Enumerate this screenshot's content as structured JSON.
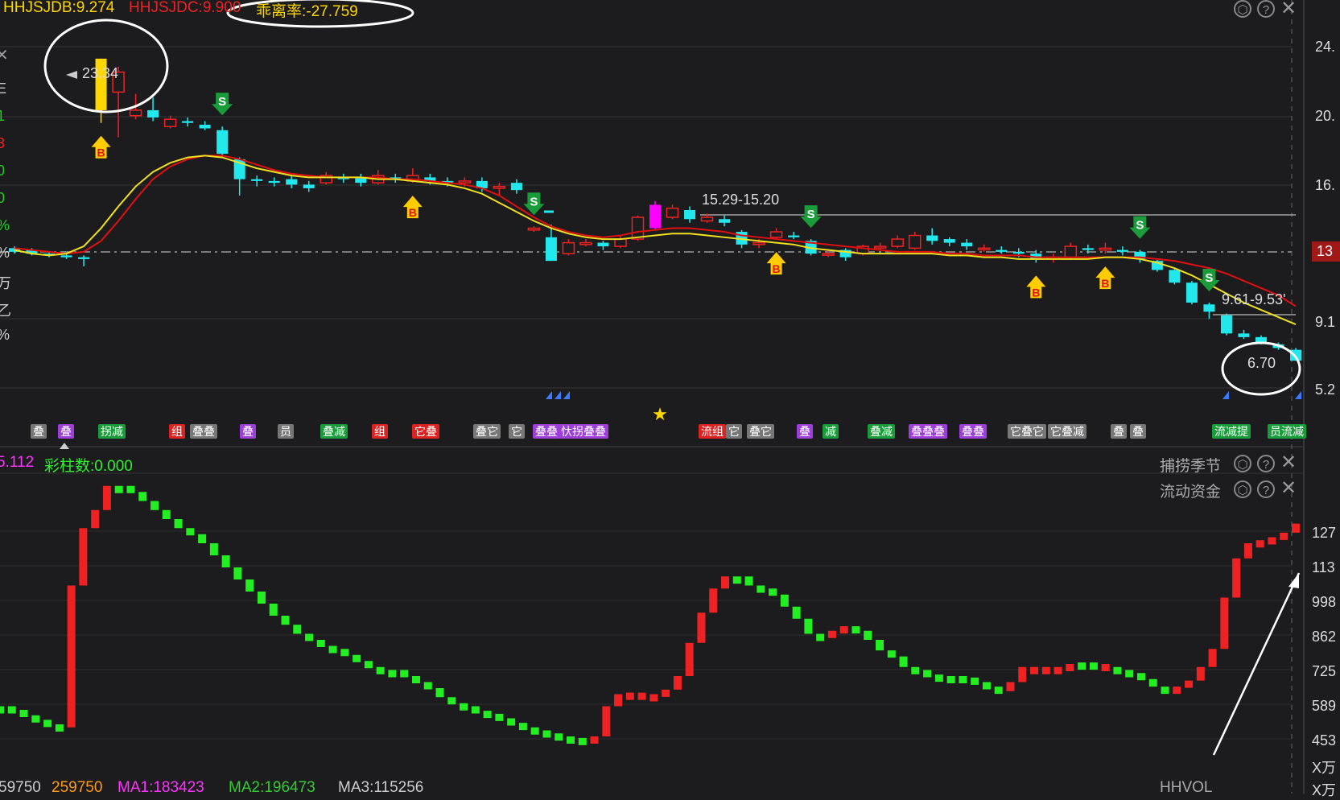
{
  "upper_header": {
    "hhjsjdb": "HHJSJDB:9.274",
    "hhjsjdc": "HHJSJDC:9.900",
    "deviation": "乖离率:-27.759"
  },
  "lower_header": {
    "value1": "5.112",
    "caizhu": "彩柱数:0.000",
    "panel_name_1": "捕捞季节",
    "panel_name_2": "流动资金"
  },
  "bottom_status": {
    "v0": "59750",
    "v1": "259750",
    "ma1": "MA1:183423",
    "ma2": "MA2:196473",
    "ma3": "MA3:115256",
    "right_name": "HHVOL"
  },
  "price_axis": [
    "24.",
    "20.",
    "16.",
    "13",
    "9.1",
    "5.2"
  ],
  "volume_axis": [
    "127",
    "113",
    "998",
    "862",
    "725",
    "589",
    "453",
    "X万",
    "X万"
  ],
  "annotations": {
    "high": "23.34",
    "range1": "15.29-15.20",
    "range2": "9.61-9.53'",
    "low": "6.70"
  },
  "left_edge_labels": [
    {
      "text": "E",
      "color": "#cccccc"
    },
    {
      "text": "1",
      "color": "#22cc22"
    },
    {
      "text": "3",
      "color": "#ee2222"
    },
    {
      "text": "0",
      "color": "#22cc22"
    },
    {
      "text": "0",
      "color": "#22cc22"
    },
    {
      "text": "%",
      "color": "#22cc22"
    },
    {
      "text": "%",
      "color": "#cccccc"
    },
    {
      "text": "万",
      "color": "#cccccc"
    },
    {
      "text": "乙",
      "color": "#cccccc"
    },
    {
      "text": "%",
      "color": "#cccccc"
    }
  ],
  "signal_tags": [
    {
      "text": "叠",
      "color": "#777777"
    },
    {
      "text": "叠",
      "color": "#9b3fd6"
    },
    {
      "text": "拐减",
      "color": "#1a9c3a"
    },
    {
      "text": "组",
      "color": "#dd2222"
    },
    {
      "text": "叠叠",
      "color": "#777777"
    },
    {
      "text": "叠",
      "color": "#9b3fd6"
    },
    {
      "text": "员",
      "color": "#777777"
    },
    {
      "text": "叠减",
      "color": "#1a9c3a"
    },
    {
      "text": "组",
      "color": "#dd2222"
    },
    {
      "text": "它叠",
      "color": "#dd2222"
    },
    {
      "text": "叠它",
      "color": "#777777"
    },
    {
      "text": "它",
      "color": "#777777"
    },
    {
      "text": "叠叠",
      "color": "#9b3fd6"
    },
    {
      "text": "忕拐叠叠",
      "color": "#9b3fd6"
    },
    {
      "text": "流组",
      "color": "#dd2222"
    },
    {
      "text": "它",
      "color": "#777777"
    },
    {
      "text": "叠它",
      "color": "#777777"
    },
    {
      "text": "叠",
      "color": "#9b3fd6"
    },
    {
      "text": "减",
      "color": "#1a9c3a"
    },
    {
      "text": "叠减",
      "color": "#1a9c3a"
    },
    {
      "text": "叠叠叠",
      "color": "#9b3fd6"
    },
    {
      "text": "叠叠",
      "color": "#9b3fd6"
    },
    {
      "text": "它叠它",
      "color": "#777777"
    },
    {
      "text": "它叠减",
      "color": "#777777"
    },
    {
      "text": "叠",
      "color": "#777777"
    },
    {
      "text": "叠",
      "color": "#777777"
    },
    {
      "text": "流减提",
      "color": "#1a9c3a"
    },
    {
      "text": "员流减",
      "color": "#1a9c3a"
    }
  ],
  "markers": {
    "buy": "B",
    "sell": "S"
  },
  "icons": [
    "settings-hex-icon",
    "help-icon",
    "close-icon",
    "collapse-icon",
    "star-icon",
    "arrow-up-right-icon"
  ],
  "colors": {
    "up": "#ee2222",
    "down": "#22e8ee",
    "yellow": "#ffd700",
    "magenta": "#ff00ff",
    "green_bar": "#22ee22"
  },
  "chart_data": [
    {
      "type": "candlestick",
      "title": "",
      "ylim": [
        5.2,
        24.0
      ],
      "price_ticks": [
        "24.",
        "20.",
        "16.",
        "13",
        "9.1",
        "5.2"
      ],
      "candles": [
        {
          "o": 12.9,
          "c": 12.7,
          "h": 13.0,
          "l": 12.6
        },
        {
          "o": 12.8,
          "c": 12.6,
          "h": 12.9,
          "l": 12.5
        },
        {
          "o": 12.6,
          "c": 12.5,
          "h": 12.7,
          "l": 12.4
        },
        {
          "o": 12.5,
          "c": 12.4,
          "h": 12.6,
          "l": 12.3
        },
        {
          "o": 12.4,
          "c": 12.3,
          "h": 12.5,
          "l": 11.9
        },
        {
          "o": 20.5,
          "c": 23.34,
          "h": 23.34,
          "l": 19.8
        },
        {
          "o": 21.5,
          "c": 22.6,
          "h": 22.9,
          "l": 19.0
        },
        {
          "o": 20.2,
          "c": 20.5,
          "h": 21.4,
          "l": 20.0
        },
        {
          "o": 20.5,
          "c": 20.1,
          "h": 21.2,
          "l": 19.9
        },
        {
          "o": 19.6,
          "c": 20.0,
          "h": 20.2,
          "l": 19.5
        },
        {
          "o": 19.9,
          "c": 19.8,
          "h": 20.1,
          "l": 19.6
        },
        {
          "o": 19.7,
          "c": 19.5,
          "h": 19.9,
          "l": 19.4
        },
        {
          "o": 19.4,
          "c": 18.1,
          "h": 19.6,
          "l": 17.9
        },
        {
          "o": 17.8,
          "c": 16.7,
          "h": 17.9,
          "l": 15.8
        },
        {
          "o": 16.7,
          "c": 16.6,
          "h": 16.9,
          "l": 16.3
        },
        {
          "o": 16.6,
          "c": 16.5,
          "h": 16.8,
          "l": 16.3
        },
        {
          "o": 16.7,
          "c": 16.4,
          "h": 16.9,
          "l": 16.2
        },
        {
          "o": 16.4,
          "c": 16.2,
          "h": 16.6,
          "l": 16.0
        },
        {
          "o": 16.5,
          "c": 16.9,
          "h": 17.1,
          "l": 16.4
        },
        {
          "o": 16.8,
          "c": 16.7,
          "h": 17.0,
          "l": 16.5
        },
        {
          "o": 16.8,
          "c": 16.5,
          "h": 17.0,
          "l": 16.3
        },
        {
          "o": 16.5,
          "c": 16.9,
          "h": 17.2,
          "l": 16.4
        },
        {
          "o": 16.8,
          "c": 16.7,
          "h": 17.0,
          "l": 16.5
        },
        {
          "o": 16.6,
          "c": 16.9,
          "h": 17.3,
          "l": 16.5
        },
        {
          "o": 16.8,
          "c": 16.6,
          "h": 17.0,
          "l": 16.4
        },
        {
          "o": 16.6,
          "c": 16.5,
          "h": 16.8,
          "l": 16.3
        },
        {
          "o": 16.5,
          "c": 16.6,
          "h": 16.8,
          "l": 16.3
        },
        {
          "o": 16.6,
          "c": 16.2,
          "h": 16.8,
          "l": 16.0
        },
        {
          "o": 16.2,
          "c": 16.3,
          "h": 16.5,
          "l": 15.8
        },
        {
          "o": 16.5,
          "c": 16.1,
          "h": 16.7,
          "l": 15.9
        },
        {
          "o": 13.9,
          "c": 14.0,
          "h": 14.1,
          "l": 13.8
        },
        {
          "o": 13.5,
          "c": 12.2,
          "h": 14.2,
          "l": 12.2
        },
        {
          "o": 12.6,
          "c": 13.2,
          "h": 13.4,
          "l": 12.5
        },
        {
          "o": 13.1,
          "c": 13.2,
          "h": 13.4,
          "l": 13.0
        },
        {
          "o": 13.2,
          "c": 13.0,
          "h": 13.3,
          "l": 12.8
        },
        {
          "o": 13.0,
          "c": 13.4,
          "h": 13.6,
          "l": 12.9
        },
        {
          "o": 13.4,
          "c": 14.6,
          "h": 14.7,
          "l": 13.3
        },
        {
          "o": 14.0,
          "c": 15.29,
          "h": 15.5,
          "l": 13.9
        },
        {
          "o": 14.6,
          "c": 15.1,
          "h": 15.3,
          "l": 14.5
        },
        {
          "o": 15.0,
          "c": 14.5,
          "h": 15.2,
          "l": 14.3
        },
        {
          "o": 14.4,
          "c": 14.6,
          "h": 14.8,
          "l": 14.3
        },
        {
          "o": 14.5,
          "c": 14.3,
          "h": 14.7,
          "l": 14.1
        },
        {
          "o": 13.8,
          "c": 13.1,
          "h": 13.9,
          "l": 12.9
        },
        {
          "o": 13.1,
          "c": 13.2,
          "h": 13.4,
          "l": 12.9
        },
        {
          "o": 13.5,
          "c": 13.8,
          "h": 14.0,
          "l": 13.4
        },
        {
          "o": 13.6,
          "c": 13.5,
          "h": 13.8,
          "l": 13.4
        },
        {
          "o": 13.3,
          "c": 12.6,
          "h": 13.4,
          "l": 12.5
        },
        {
          "o": 12.6,
          "c": 12.6,
          "h": 12.8,
          "l": 12.4
        },
        {
          "o": 12.8,
          "c": 12.4,
          "h": 12.9,
          "l": 12.2
        },
        {
          "o": 12.6,
          "c": 13.0,
          "h": 13.1,
          "l": 12.5
        },
        {
          "o": 13.0,
          "c": 13.0,
          "h": 13.2,
          "l": 12.8
        },
        {
          "o": 13.0,
          "c": 13.4,
          "h": 13.6,
          "l": 12.9
        },
        {
          "o": 12.9,
          "c": 13.6,
          "h": 13.8,
          "l": 12.8
        },
        {
          "o": 13.6,
          "c": 13.3,
          "h": 14.0,
          "l": 13.1
        },
        {
          "o": 13.4,
          "c": 13.2,
          "h": 13.5,
          "l": 13.0
        },
        {
          "o": 13.2,
          "c": 13.0,
          "h": 13.4,
          "l": 12.8
        },
        {
          "o": 12.9,
          "c": 12.9,
          "h": 13.1,
          "l": 12.7
        },
        {
          "o": 12.8,
          "c": 12.7,
          "h": 13.0,
          "l": 12.6
        },
        {
          "o": 12.7,
          "c": 12.6,
          "h": 12.9,
          "l": 12.4
        },
        {
          "o": 12.6,
          "c": 12.3,
          "h": 12.8,
          "l": 12.1
        },
        {
          "o": 12.3,
          "c": 12.4,
          "h": 12.6,
          "l": 12.1
        },
        {
          "o": 12.4,
          "c": 13.0,
          "h": 13.2,
          "l": 12.3
        },
        {
          "o": 12.9,
          "c": 12.8,
          "h": 13.1,
          "l": 12.6
        },
        {
          "o": 12.8,
          "c": 12.9,
          "h": 13.2,
          "l": 12.6
        },
        {
          "o": 12.8,
          "c": 12.7,
          "h": 13.0,
          "l": 12.5
        },
        {
          "o": 12.7,
          "c": 12.3,
          "h": 12.8,
          "l": 12.1
        },
        {
          "o": 12.2,
          "c": 11.7,
          "h": 12.3,
          "l": 11.6
        },
        {
          "o": 11.7,
          "c": 11.0,
          "h": 11.8,
          "l": 10.9
        },
        {
          "o": 11.0,
          "c": 9.9,
          "h": 11.1,
          "l": 9.8
        },
        {
          "o": 9.8,
          "c": 9.4,
          "h": 9.9,
          "l": 9.0
        },
        {
          "o": 9.2,
          "c": 8.2,
          "h": 9.3,
          "l": 8.1
        },
        {
          "o": 8.2,
          "c": 8.0,
          "h": 8.4,
          "l": 7.9
        },
        {
          "o": 8.0,
          "c": 7.7,
          "h": 8.1,
          "l": 7.6
        },
        {
          "o": 7.6,
          "c": 7.4,
          "h": 7.7,
          "l": 7.3
        },
        {
          "o": 7.3,
          "c": 6.7,
          "h": 7.4,
          "l": 6.7
        }
      ],
      "ma_yellow": [
        12.8,
        12.6,
        12.5,
        12.6,
        13.0,
        14.0,
        15.2,
        16.3,
        17.1,
        17.6,
        17.9,
        18.0,
        17.9,
        17.6,
        17.3,
        17.1,
        16.9,
        16.8,
        16.8,
        16.8,
        16.8,
        16.7,
        16.7,
        16.6,
        16.5,
        16.4,
        16.2,
        15.9,
        15.4,
        14.9,
        14.4,
        14.0,
        13.7,
        13.5,
        13.4,
        13.4,
        13.5,
        13.6,
        13.7,
        13.7,
        13.6,
        13.5,
        13.4,
        13.3,
        13.2,
        13.1,
        12.9,
        12.8,
        12.7,
        12.6,
        12.6,
        12.6,
        12.6,
        12.6,
        12.5,
        12.5,
        12.4,
        12.4,
        12.3,
        12.3,
        12.3,
        12.3,
        12.3,
        12.4,
        12.4,
        12.3,
        12.1,
        11.8,
        11.4,
        10.9,
        10.4,
        9.9,
        9.5,
        9.1,
        8.7
      ],
      "ma_red": [
        12.9,
        12.8,
        12.7,
        12.6,
        12.7,
        13.3,
        14.4,
        15.6,
        16.7,
        17.4,
        17.8,
        18.0,
        18.0,
        17.8,
        17.5,
        17.2,
        17.0,
        16.9,
        16.8,
        16.8,
        16.8,
        16.8,
        16.7,
        16.7,
        16.6,
        16.5,
        16.4,
        16.2,
        15.8,
        15.2,
        14.6,
        14.1,
        13.8,
        13.6,
        13.5,
        13.6,
        13.8,
        13.9,
        14.0,
        14.0,
        13.9,
        13.8,
        13.6,
        13.5,
        13.4,
        13.3,
        13.2,
        13.1,
        13.0,
        12.9,
        12.8,
        12.7,
        12.7,
        12.7,
        12.6,
        12.6,
        12.5,
        12.5,
        12.5,
        12.4,
        12.4,
        12.4,
        12.4,
        12.4,
        12.4,
        12.4,
        12.3,
        12.2,
        12.0,
        11.8,
        11.5,
        11.1,
        10.7,
        10.3,
        9.7
      ],
      "buy_signal_index": [
        5,
        23,
        44,
        59,
        63
      ],
      "sell_signal_index": [
        12,
        30,
        46,
        65,
        69
      ]
    },
    {
      "type": "bar",
      "title": "",
      "ylabel": "X万",
      "ylim": [
        300,
        1300
      ],
      "y_ticks": [
        "127",
        "113",
        "998",
        "862",
        "725",
        "589",
        "453"
      ],
      "values": [
        560,
        548,
        530,
        515,
        500,
        490,
        960,
        1150,
        1210,
        1290,
        1290,
        1270,
        1240,
        1210,
        1180,
        1150,
        1130,
        1100,
        1060,
        1020,
        980,
        940,
        900,
        860,
        830,
        800,
        780,
        760,
        750,
        730,
        710,
        690,
        680,
        680,
        660,
        640,
        620,
        590,
        570,
        560,
        545,
        535,
        520,
        505,
        490,
        480,
        470,
        460,
        455,
        440,
        460,
        560,
        600,
        605,
        600,
        600,
        615,
        660,
        770,
        870,
        950,
        990,
        990,
        960,
        950,
        930,
        890,
        850,
        800,
        800,
        810,
        825,
        810,
        780,
        745,
        725,
        690,
        680,
        665,
        655,
        660,
        655,
        640,
        625,
        610,
        640,
        690,
        690,
        680,
        690,
        700,
        705,
        700,
        690,
        680,
        670,
        650,
        625,
        610,
        625,
        645,
        690,
        750,
        920,
        1050,
        1100,
        1110,
        1120,
        1135,
        1165
      ],
      "colors": [
        "g",
        "g",
        "g",
        "g",
        "g",
        "g",
        "r",
        "r",
        "r",
        "r",
        "g",
        "g",
        "g",
        "g",
        "g",
        "g",
        "g",
        "g",
        "g",
        "g",
        "g",
        "g",
        "g",
        "g",
        "g",
        "g",
        "g",
        "g",
        "g",
        "g",
        "g",
        "g",
        "g",
        "g",
        "g",
        "g",
        "g",
        "g",
        "g",
        "g",
        "g",
        "g",
        "g",
        "g",
        "g",
        "g",
        "g",
        "g",
        "g",
        "g",
        "r",
        "r",
        "r",
        "r",
        "r",
        "r",
        "r",
        "r",
        "r",
        "r",
        "r",
        "r",
        "g",
        "g",
        "g",
        "g",
        "g",
        "g",
        "g",
        "g",
        "r",
        "r",
        "g",
        "g",
        "g",
        "g",
        "g",
        "g",
        "g",
        "g",
        "g",
        "g",
        "g",
        "g",
        "g",
        "r",
        "r",
        "r",
        "r",
        "r",
        "r",
        "g",
        "g",
        "r",
        "g",
        "g",
        "g",
        "g",
        "g",
        "r",
        "r",
        "r",
        "r",
        "r",
        "r",
        "r",
        "r",
        "r",
        "r",
        "r",
        "r"
      ]
    }
  ]
}
